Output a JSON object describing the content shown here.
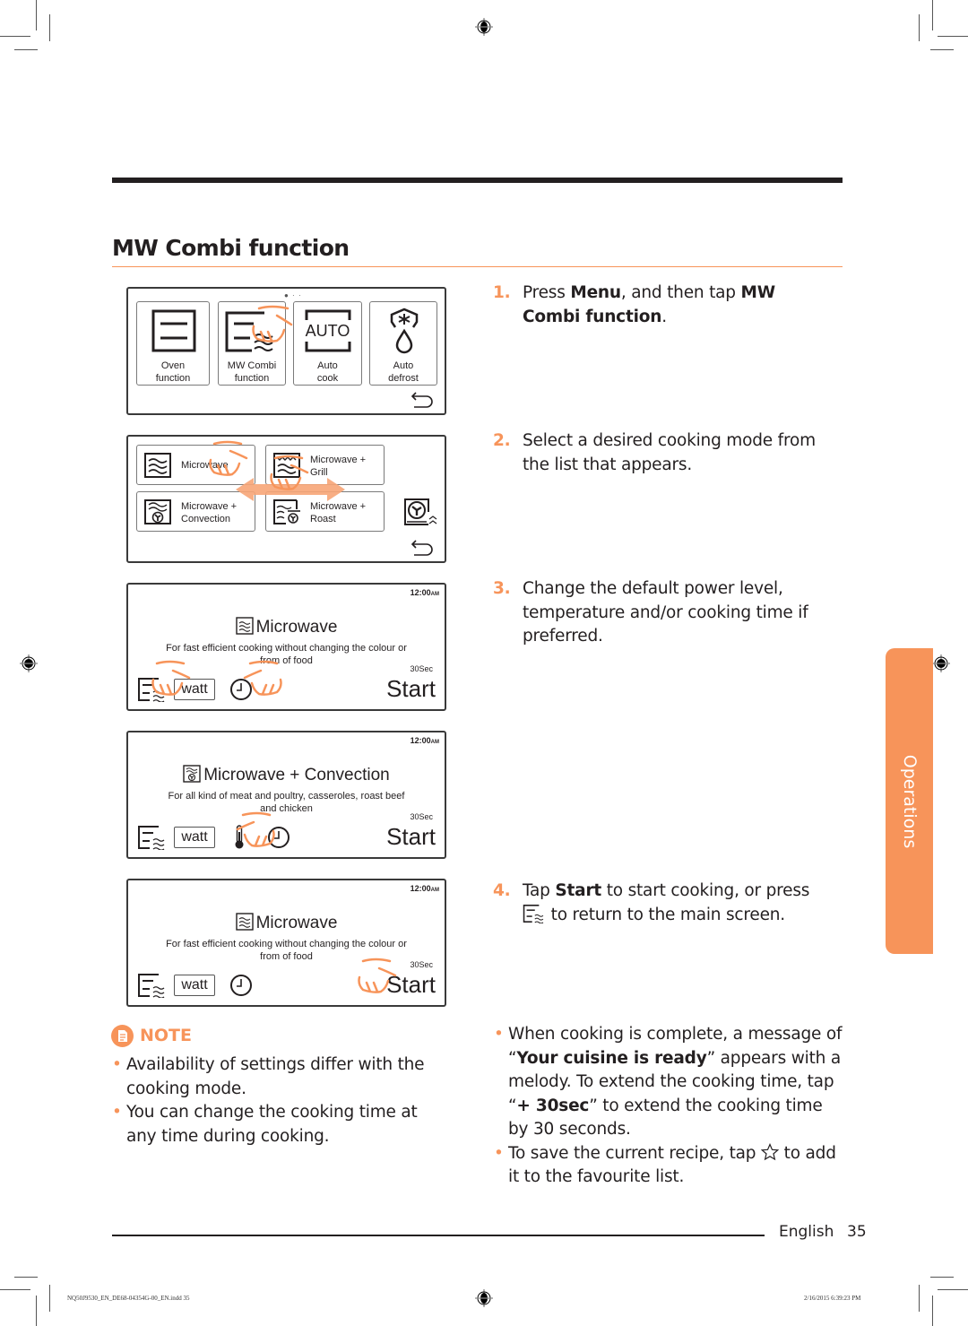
{
  "page": {
    "title": "MW Combi function",
    "side_tab": "Operations",
    "footer": {
      "language": "English",
      "page_number": "35"
    },
    "slug": {
      "file": "NQ50J9530_EN_DE68-04354G-00_EN.indd   35",
      "timestamp": "2/16/2015   6:39:23 PM"
    },
    "colors": {
      "accent": "#f7945a",
      "text": "#231f20",
      "rule": "#231f20"
    }
  },
  "screens": {
    "menu": {
      "tiles": [
        {
          "icon": "oven-function-icon",
          "line1": "Oven",
          "line2": "function"
        },
        {
          "icon": "mw-combi-icon",
          "line1": "MW Combi",
          "line2": "function"
        },
        {
          "icon": "auto-cook-icon",
          "icon_text": "AUTO",
          "line1": "Auto",
          "line2": "cook"
        },
        {
          "icon": "auto-defrost-icon",
          "line1": "Auto",
          "line2": "defrost"
        }
      ],
      "back_icon": "back-arrow-icon"
    },
    "modes": {
      "tiles": [
        {
          "icon": "microwave-icon",
          "line1": "Microwave",
          "line2": ""
        },
        {
          "icon": "microwave-grill-icon",
          "line1": "Microwave +",
          "line2": "Grill"
        },
        {
          "icon": "microwave-convection-icon",
          "line1": "Microwave +",
          "line2": "Convection"
        },
        {
          "icon": "microwave-roast-icon",
          "line1": "Microwave +",
          "line2": "Roast"
        }
      ],
      "side_icon": "fan-oven-icon",
      "back_icon": "back-arrow-icon"
    },
    "detail": [
      {
        "clock": "12:00",
        "clock_suffix": "AM",
        "mode": "Microwave",
        "desc_line1": "For fast efficient cooking without changing the colour or",
        "desc_line2": "from of food",
        "watt_label": "watt",
        "time": "30Sec",
        "start": "Start"
      },
      {
        "clock": "12:00",
        "clock_suffix": "AM",
        "mode": "Microwave + Convection",
        "desc_line1": "For all kind of meat and poultry, casseroles, roast beef",
        "desc_line2": "and chicken",
        "watt_label": "watt",
        "time": "30Sec",
        "start": "Start"
      },
      {
        "clock": "12:00",
        "clock_suffix": "AM",
        "mode": "Microwave",
        "desc_line1": "For fast efficient cooking without changing the colour or",
        "desc_line2": "from of food",
        "watt_label": "watt",
        "time": "30Sec",
        "start": "Start"
      }
    ]
  },
  "steps": [
    {
      "num": "1.",
      "parts": [
        "Press ",
        "Menu",
        ", and then tap ",
        "MW Combi function",
        "."
      ]
    },
    {
      "num": "2.",
      "text": "Select a desired cooking mode from the list that appears."
    },
    {
      "num": "3.",
      "text": "Change the default power level, temperature and/or cooking time if preferred."
    },
    {
      "num": "4.",
      "parts": [
        "Tap ",
        "Start",
        " to start cooking, or press ",
        " to return to the main screen."
      ]
    }
  ],
  "note": {
    "label": "NOTE",
    "items": [
      "Availability of settings differ with the cooking mode.",
      "You can change the cooking time at any time during cooking."
    ]
  },
  "tips": {
    "item1": {
      "a": "When cooking is complete, a message of “",
      "b": "Your cuisine is ready",
      "c": "” appears with a melody. To extend the cooking time, tap “",
      "d": "+ 30sec",
      "e": "” to extend the cooking time by 30 seconds."
    },
    "item2": {
      "a": "To save the current recipe, tap ",
      "b": " to add it to the favourite list."
    }
  },
  "bullet": "•"
}
